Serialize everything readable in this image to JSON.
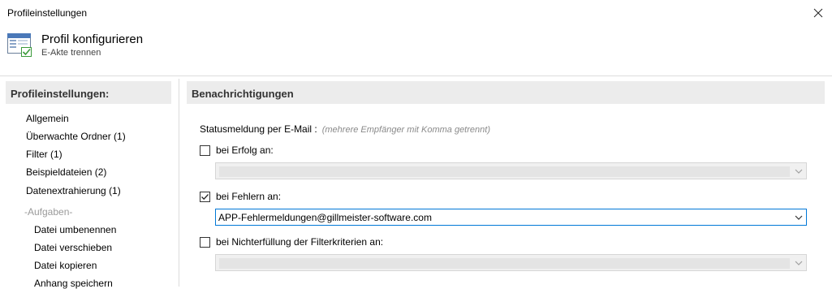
{
  "window": {
    "title": "Profileinstellungen"
  },
  "header": {
    "title": "Profil konfigurieren",
    "subtitle": "E-Akte trennen"
  },
  "sidebar": {
    "heading": "Profileinstellungen:",
    "items": [
      {
        "label": "Allgemein"
      },
      {
        "label": "Überwachte Ordner (1)"
      },
      {
        "label": "Filter (1)"
      },
      {
        "label": "Beispieldateien (2)"
      },
      {
        "label": "Datenextrahierung (1)"
      }
    ],
    "group_label": "-Aufgaben-",
    "sub_items": [
      {
        "label": "Datei umbenennen"
      },
      {
        "label": "Datei verschieben"
      },
      {
        "label": "Datei kopieren"
      },
      {
        "label": "Anhang speichern"
      }
    ]
  },
  "main": {
    "heading": "Benachrichtigungen",
    "status_label": "Statusmeldung per E-Mail :",
    "status_hint": "(mehrere Empfänger mit Komma getrennt)",
    "options": [
      {
        "label": "bei Erfolg an:",
        "checked": false,
        "value": ""
      },
      {
        "label": "bei Fehlern an:",
        "checked": true,
        "value": "APP-Fehlermeldungen@gillmeister-software.com"
      },
      {
        "label": "bei Nichterfüllung der Filterkriterien an:",
        "checked": false,
        "value": ""
      }
    ]
  },
  "icons": {
    "close": "close-icon",
    "profile": "profile-config-icon",
    "dropdown": "chevron-down-icon",
    "check": "checkmark-icon"
  },
  "colors": {
    "focus_border": "#0078d7",
    "section_header_bg": "#ececec",
    "icon_check": "#3a9a3a"
  }
}
